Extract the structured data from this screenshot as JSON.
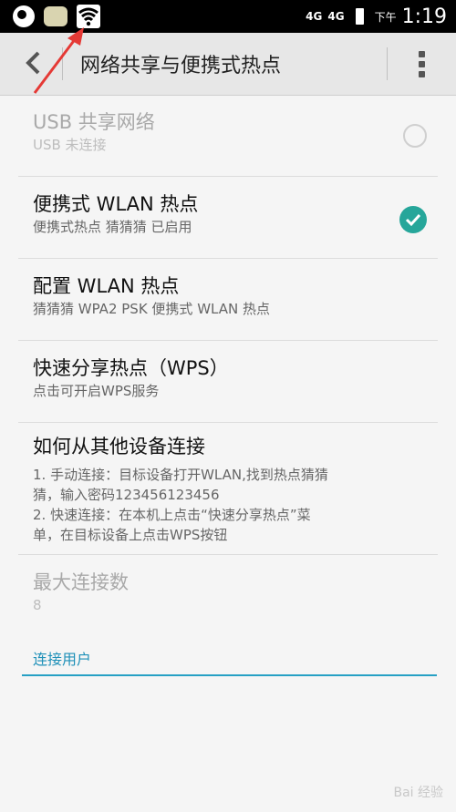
{
  "status_bar": {
    "network_1": "4G",
    "network_2": "4G",
    "ampm": "下午",
    "time": "1:19"
  },
  "action_bar": {
    "title": "网络共享与便携式热点"
  },
  "items": [
    {
      "title": "USB 共享网络",
      "subtitle": "USB 未连接"
    },
    {
      "title": "便携式 WLAN 热点",
      "subtitle": "便携式热点 猜猜猜 已启用"
    },
    {
      "title": "配置 WLAN 热点",
      "subtitle": "猜猜猜 WPA2 PSK 便携式 WLAN 热点"
    },
    {
      "title": "快速分享热点（WPS）",
      "subtitle": "点击可开启WPS服务"
    },
    {
      "title": "如何从其他设备连接",
      "subtitle_lines": [
        "1. 手动连接：目标设备打开WLAN,找到热点猜猜",
        "猜，输入密码123456123456",
        "2. 快速连接：在本机上点击“快速分享热点”菜",
        "单，在目标设备上点击WPS按钮"
      ]
    },
    {
      "title": "最大连接数",
      "subtitle": "8"
    }
  ],
  "section": {
    "connected_users": "连接用户"
  },
  "watermark": "Bai 经验",
  "colors": {
    "accent": "#26a69a",
    "section": "#1e90b8",
    "arrow": "#e53935"
  }
}
